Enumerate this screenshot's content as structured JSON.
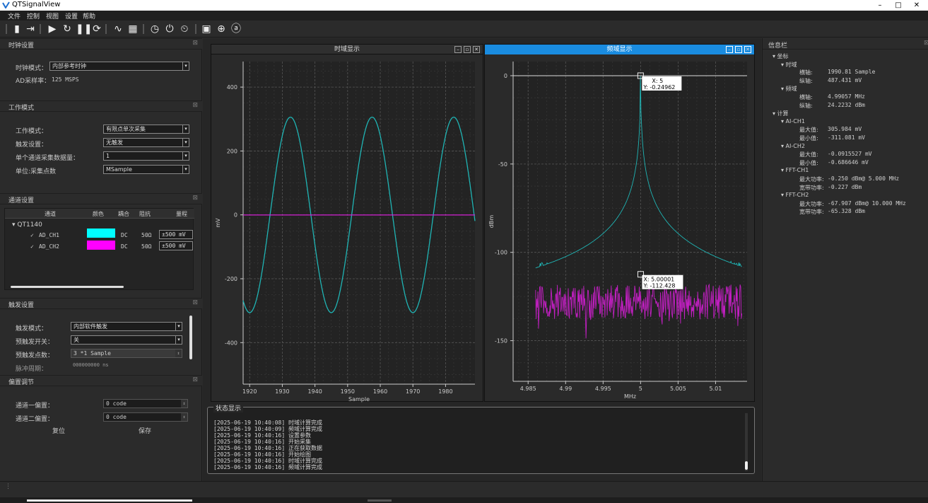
{
  "window": {
    "title": "QTSignalView",
    "min": "–",
    "max": "□",
    "close": "✕"
  },
  "menu": [
    "文件",
    "控制",
    "视图",
    "设置",
    "帮助"
  ],
  "clock": {
    "title": "时钟设置",
    "mode_label": "时钟模式：",
    "mode_value": "内部参考时钟",
    "rate_label": "AD采样率：",
    "rate_value": "125 MSPS"
  },
  "work": {
    "title": "工作模式",
    "rows": [
      {
        "label": "工作模式：",
        "value": "有限点单次采集"
      },
      {
        "label": "触发设置：",
        "value": "无触发"
      },
      {
        "label": "单个通道采集数据量：",
        "value": "1"
      },
      {
        "label": "单位:采集点数",
        "value": "MSample"
      }
    ]
  },
  "channel": {
    "title": "通道设置",
    "headers": [
      "通道",
      "颜色",
      "耦合",
      "阻抗",
      "量程"
    ],
    "device": "QT1140",
    "rows": [
      {
        "name": "AD_CH1",
        "color": "#00ffff",
        "coupling": "DC",
        "impedance": "50Ω",
        "range": "±500 mV"
      },
      {
        "name": "AD_CH2",
        "color": "#ff00ff",
        "coupling": "DC",
        "impedance": "50Ω",
        "range": "±500 mV"
      }
    ]
  },
  "trigger": {
    "title": "触发设置",
    "rows": [
      {
        "label": "触发模式：",
        "value": "内部软件触发"
      },
      {
        "label": "预触发开关：",
        "value": "关"
      },
      {
        "label": "预触发点数：",
        "value": "3 *1 Sample"
      },
      {
        "label": "脉冲周期：",
        "value": "000000000 ns"
      }
    ]
  },
  "offset": {
    "title": "偏置调节",
    "ch1_label": "通道一偏置：",
    "ch1_value": "0 code",
    "ch2_label": "通道二偏置：",
    "ch2_value": "0 code",
    "reset": "复位",
    "save": "保存"
  },
  "time_plot": {
    "title": "时域显示",
    "xlabel": "Sample",
    "ylabel": "mV"
  },
  "freq_plot": {
    "title": "频域显示",
    "xlabel": "MHz",
    "ylabel": "dBm",
    "marker1": {
      "x": "X: 5",
      "y": "Y: -0.24962"
    },
    "marker2": {
      "x": "X: 5.00001",
      "y": "Y: -112.428"
    }
  },
  "info": {
    "title": "信息栏",
    "items": [
      {
        "text": "▾ 坐标",
        "lvl": 0
      },
      {
        "text": "▾ 时域",
        "lvl": 1
      },
      {
        "text": "横轴:",
        "val": "1990.81 Sample",
        "lvl": 2
      },
      {
        "text": "纵轴:",
        "val": "487.431 mV",
        "lvl": 2
      },
      {
        "text": "▾ 频域",
        "lvl": 1
      },
      {
        "text": "横轴:",
        "val": "4.99057 MHz",
        "lvl": 2
      },
      {
        "text": "纵轴:",
        "val": "24.2232 dBm",
        "lvl": 2
      },
      {
        "text": "▾ 计算",
        "lvl": 0
      },
      {
        "text": "▾ AI-CH1",
        "lvl": 1
      },
      {
        "text": "最大值:",
        "val": "305.984 mV",
        "lvl": 2
      },
      {
        "text": "最小值:",
        "val": "-311.081 mV",
        "lvl": 2
      },
      {
        "text": "▾ AI-CH2",
        "lvl": 1
      },
      {
        "text": "最大值:",
        "val": "-0.0915527 mV",
        "lvl": 2
      },
      {
        "text": "最小值:",
        "val": "-0.686646 mV",
        "lvl": 2
      },
      {
        "text": "▾ FFT-CH1",
        "lvl": 1
      },
      {
        "text": "最大功率:",
        "val": "-0.250 dBm@ 5.000 MHz",
        "lvl": 2
      },
      {
        "text": "宽带功率:",
        "val": "-0.227 dBm",
        "lvl": 2
      },
      {
        "text": "▾ FFT-CH2",
        "lvl": 1
      },
      {
        "text": "最大功率:",
        "val": "-67.907 dBm@ 10.000 MHz",
        "lvl": 2
      },
      {
        "text": "宽带功率:",
        "val": "-65.328 dBm",
        "lvl": 2
      }
    ]
  },
  "status": {
    "title": "状态显示",
    "lines": [
      "[2025-06-19 10:40:08] 时域计算完成",
      "[2025-06-19 10:40:09] 频域计算完成",
      "[2025-06-19 10:40:16] 设置参数",
      "[2025-06-19 10:40:16] 开始采集",
      "[2025-06-19 10:40:16] 正在获取数据",
      "[2025-06-19 10:40:16] 开始绘图",
      "[2025-06-19 10:40:16] 时域计算完成",
      "[2025-06-19 10:40:16] 频域计算完成"
    ]
  },
  "chart_data": [
    {
      "type": "line",
      "title": "时域显示",
      "xlabel": "Sample",
      "ylabel": "mV",
      "xlim": [
        1918,
        1989
      ],
      "ylim": [
        -530,
        480
      ],
      "x_ticks": [
        1920,
        1930,
        1940,
        1950,
        1960,
        1970,
        1980
      ],
      "y_ticks": [
        -400,
        -200,
        0,
        200,
        400
      ],
      "series": [
        {
          "name": "AI-CH1",
          "color": "#1fb5b5",
          "waveform": "sine",
          "amplitude": 305.984,
          "period_samples": 25,
          "peak_sample": 1932.5
        },
        {
          "name": "AI-CH2",
          "color": "#d21fd2",
          "waveform": "flat",
          "value": -0.4
        }
      ]
    },
    {
      "type": "line",
      "title": "频域显示",
      "xlabel": "MHz",
      "ylabel": "dBm",
      "xlim": [
        4.983,
        5.0142
      ],
      "ylim": [
        -173,
        8
      ],
      "x_ticks": [
        4.985,
        4.99,
        4.995,
        5,
        5.005,
        5.01
      ],
      "y_ticks": [
        -150,
        -100,
        -50,
        0
      ],
      "series": [
        {
          "name": "FFT-CH1",
          "color": "#1fb5b5",
          "peak_x": 5,
          "peak_y": -0.25,
          "noise_floor": -113
        },
        {
          "name": "FFT-CH2",
          "color": "#c21fc2",
          "noise_floor": -128
        }
      ]
    }
  ]
}
